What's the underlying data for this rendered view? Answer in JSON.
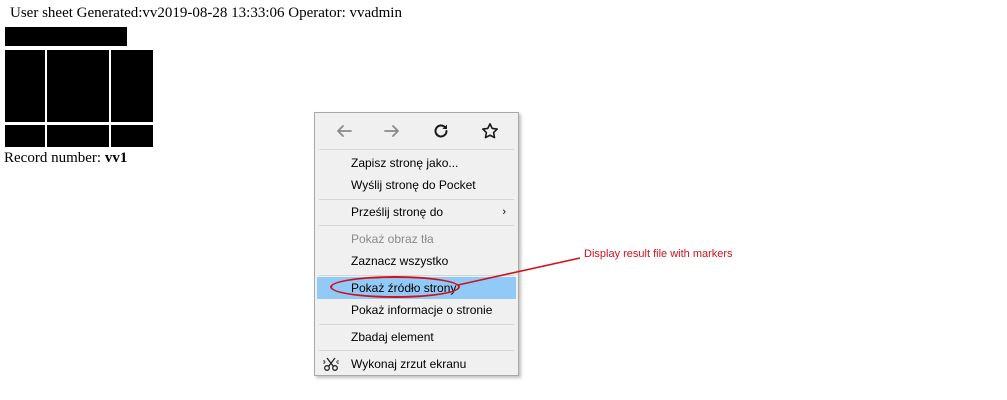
{
  "page": {
    "header_text": "User sheet Generated:vv2019-08-28 13:33:06 Operator: vvadmin",
    "record_label": "Record number: ",
    "record_value": "vv1"
  },
  "context_menu": {
    "nav": [
      {
        "name": "back",
        "icon": "arrow-left-icon",
        "enabled": false
      },
      {
        "name": "forward",
        "icon": "arrow-right-icon",
        "enabled": false
      },
      {
        "name": "reload",
        "icon": "reload-icon",
        "enabled": true
      },
      {
        "name": "bookmark",
        "icon": "star-icon",
        "enabled": true
      }
    ],
    "items": [
      {
        "label": "Zapisz stronę jako..."
      },
      {
        "label": "Wyślij stronę do Pocket"
      },
      {
        "label": "Prześlij stronę do",
        "submenu": true
      },
      {
        "label": "Pokaż obraz tła",
        "disabled": true
      },
      {
        "label": "Zaznacz wszystko"
      },
      {
        "label": "Pokaż źródło strony",
        "highlighted": true
      },
      {
        "label": "Pokaż informacje o stronie"
      },
      {
        "label": "Zbadaj element"
      },
      {
        "label": "Wykonaj zrzut ekranu",
        "icon": "screenshot-icon"
      }
    ]
  },
  "annotation": {
    "text": "Display result file with markers",
    "color": "#d0111b"
  },
  "colors": {
    "highlight": "#91c9f7",
    "menu_background": "#f0f0f0"
  }
}
